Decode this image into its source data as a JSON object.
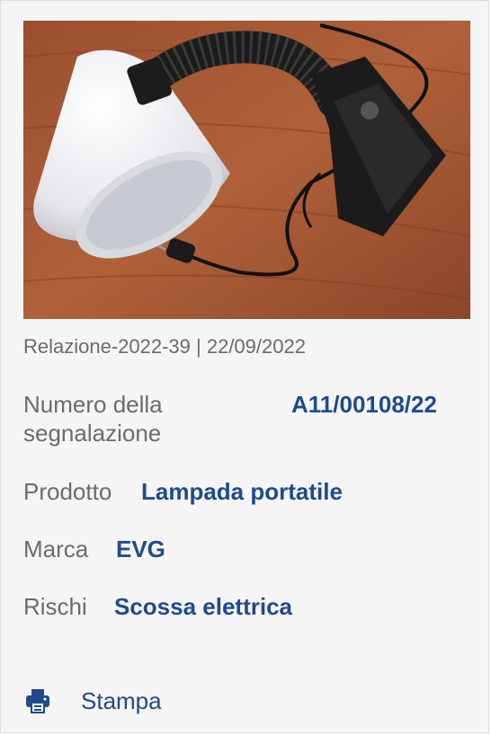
{
  "report": {
    "meta": "Relazione-2022-39 | 22/09/2022"
  },
  "fields": {
    "numero_label": "Numero della segnalazione",
    "numero_value": "A11/00108/22",
    "prodotto_label": "Prodotto",
    "prodotto_value": "Lampada portatile",
    "marca_label": "Marca",
    "marca_value": "EVG",
    "rischi_label": "Rischi",
    "rischi_value": "Scossa elettrica"
  },
  "actions": {
    "print_label": "Stampa",
    "print_icon": "printer-icon"
  },
  "colors": {
    "accent": "#1f4a8e",
    "label_text": "#6b6b6b",
    "card_background": "#f5f5f5"
  }
}
